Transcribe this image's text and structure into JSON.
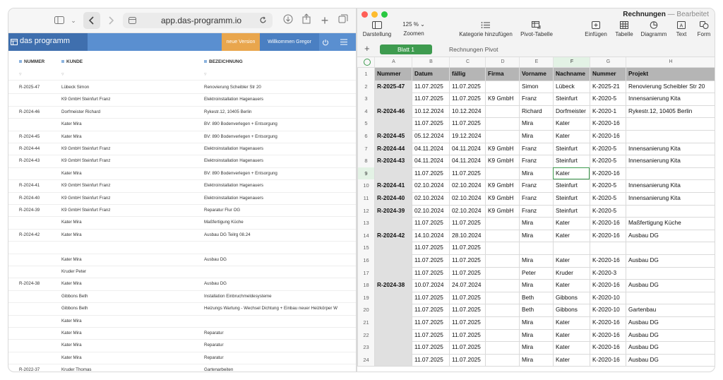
{
  "browser": {
    "url": "app.das-programm.io",
    "app_name": "das programm",
    "new_version": "neue Version",
    "welcome": "Willkommen Gregor",
    "columns": [
      "NUMMER",
      "KUNDE",
      "BEZEICHNUNG"
    ],
    "rows": [
      {
        "nr": "R-2025-47",
        "kunde": "Lübeck Simon",
        "bez": "Renovierung Scheibler Str 20"
      },
      {
        "nr": "",
        "kunde": "K9 GmbH Steinfurt Franz",
        "bez": "Elektroinstallation Hagenauers"
      },
      {
        "nr": "R-2024-46",
        "kunde": "Dorfmeister Richard",
        "bez": "Rykestr.12, 10405 Berlin"
      },
      {
        "nr": "",
        "kunde": "Kater Mira",
        "bez": "BV: 890 Bodenverlegen + Entsorgung"
      },
      {
        "nr": "R-2024-45",
        "kunde": "Kater Mira",
        "bez": "BV: 890 Bodenverlegen + Entsorgung"
      },
      {
        "nr": "R-2024-44",
        "kunde": "K9 GmbH Steinfurt Franz",
        "bez": "Elektroinstallation Hagenauers"
      },
      {
        "nr": "R-2024-43",
        "kunde": "K9 GmbH Steinfurt Franz",
        "bez": "Elektroinstallation Hagenauers"
      },
      {
        "nr": "",
        "kunde": "Kater Mira",
        "bez": "BV: 890 Bodenverlegen + Entsorgung"
      },
      {
        "nr": "R-2024-41",
        "kunde": "K9 GmbH Steinfurt Franz",
        "bez": "Elektroinstallation Hagenauers"
      },
      {
        "nr": "R-2024-40",
        "kunde": "K9 GmbH Steinfurt Franz",
        "bez": "Elektroinstallation Hagenauers"
      },
      {
        "nr": "R-2024-39",
        "kunde": "K9 GmbH Steinfurt Franz",
        "bez": "Reparatur Flur OG"
      },
      {
        "nr": "",
        "kunde": "Kater Mira",
        "bez": "Maßfertigung Küche"
      },
      {
        "nr": "R-2024-42",
        "kunde": "Kater Mira",
        "bez": "Ausbau DG Teilrg 08.24"
      },
      {
        "nr": "",
        "kunde": "",
        "bez": ""
      },
      {
        "nr": "",
        "kunde": "Kater Mira",
        "bez": "Ausbau DG"
      },
      {
        "nr": "",
        "kunde": "Kruder Peter",
        "bez": ""
      },
      {
        "nr": "R-2024-38",
        "kunde": "Kater Mira",
        "bez": "Ausbau DG"
      },
      {
        "nr": "",
        "kunde": "Gibbons Beth",
        "bez": "Installation Einbruchmeldesysteme"
      },
      {
        "nr": "",
        "kunde": "Gibbons Beth",
        "bez": "Heizungs Wartung - Wechsel Dichtung + Einbau neuer Heizkörper W"
      },
      {
        "nr": "",
        "kunde": "Kater Mira",
        "bez": ""
      },
      {
        "nr": "",
        "kunde": "Kater Mira",
        "bez": "Reparatur"
      },
      {
        "nr": "",
        "kunde": "Kater Mira",
        "bez": "Reparatur"
      },
      {
        "nr": "",
        "kunde": "Kater Mira",
        "bez": "Reparatur"
      },
      {
        "nr": "R-2022-37",
        "kunde": "Kruder Thomas",
        "bez": "Gartenarbeiten"
      }
    ]
  },
  "numbers": {
    "doc_title": "Rechnungen",
    "doc_sep": "—",
    "doc_status": "Bearbeitet",
    "zoom": "125 %",
    "toolbar": {
      "darstellung": "Darstellung",
      "zoomen": "Zoomen",
      "kategorie": "Kategorie hinzufügen",
      "pivot": "Pivot-Tabelle",
      "einfuegen": "Einfügen",
      "tabelle": "Tabelle",
      "diagramm": "Diagramm",
      "text": "Text",
      "form": "Form"
    },
    "sheets": [
      "Blatt 1",
      "Rechnungen Pivot"
    ],
    "col_letters": [
      "A",
      "B",
      "C",
      "D",
      "E",
      "F",
      "G",
      "H"
    ],
    "header": [
      "Nummer",
      "Datum",
      "fällig",
      "Firma",
      "Vorname",
      "Nachname",
      "Nummer",
      "Projekt"
    ],
    "rows": [
      [
        "R-2025-47",
        "11.07.2025",
        "11.07.2025",
        "",
        "Simon",
        "Lübeck",
        "K-2025-21",
        "Renovierung Scheibler Str 20"
      ],
      [
        "",
        "11.07.2025",
        "11.07.2025",
        "K9 GmbH",
        "Franz",
        "Steinfurt",
        "K-2020-5",
        "Innensanierung Kita"
      ],
      [
        "R-2024-46",
        "10.12.2024",
        "10.12.2024",
        "",
        "Richard",
        "Dorfmeister",
        "K-2020-1",
        "Rykestr.12, 10405 Berlin"
      ],
      [
        "",
        "11.07.2025",
        "11.07.2025",
        "",
        "Mira",
        "Kater",
        "K-2020-16",
        ""
      ],
      [
        "R-2024-45",
        "05.12.2024",
        "19.12.2024",
        "",
        "Mira",
        "Kater",
        "K-2020-16",
        ""
      ],
      [
        "R-2024-44",
        "04.11.2024",
        "04.11.2024",
        "K9 GmbH",
        "Franz",
        "Steinfurt",
        "K-2020-5",
        "Innensanierung Kita"
      ],
      [
        "R-2024-43",
        "04.11.2024",
        "04.11.2024",
        "K9 GmbH",
        "Franz",
        "Steinfurt",
        "K-2020-5",
        "Innensanierung Kita"
      ],
      [
        "",
        "11.07.2025",
        "11.07.2025",
        "",
        "Mira",
        "Kater",
        "K-2020-16",
        ""
      ],
      [
        "R-2024-41",
        "02.10.2024",
        "02.10.2024",
        "K9 GmbH",
        "Franz",
        "Steinfurt",
        "K-2020-5",
        "Innensanierung Kita"
      ],
      [
        "R-2024-40",
        "02.10.2024",
        "02.10.2024",
        "K9 GmbH",
        "Franz",
        "Steinfurt",
        "K-2020-5",
        "Innensanierung Kita"
      ],
      [
        "R-2024-39",
        "02.10.2024",
        "02.10.2024",
        "K9 GmbH",
        "Franz",
        "Steinfurt",
        "K-2020-5",
        ""
      ],
      [
        "",
        "11.07.2025",
        "11.07.2025",
        "",
        "Mira",
        "Kater",
        "K-2020-16",
        "Maßfertigung Küche"
      ],
      [
        "R-2024-42",
        "14.10.2024",
        "28.10.2024",
        "",
        "Mira",
        "Kater",
        "K-2020-16",
        "Ausbau DG"
      ],
      [
        "",
        "11.07.2025",
        "11.07.2025",
        "",
        "",
        "",
        "",
        ""
      ],
      [
        "",
        "11.07.2025",
        "11.07.2025",
        "",
        "Mira",
        "Kater",
        "K-2020-16",
        "Ausbau DG"
      ],
      [
        "",
        "11.07.2025",
        "11.07.2025",
        "",
        "Peter",
        "Kruder",
        "K-2020-3",
        ""
      ],
      [
        "R-2024-38",
        "10.07.2024",
        "24.07.2024",
        "",
        "Mira",
        "Kater",
        "K-2020-16",
        "Ausbau DG"
      ],
      [
        "",
        "11.07.2025",
        "11.07.2025",
        "",
        "Beth",
        "Gibbons",
        "K-2020-10",
        ""
      ],
      [
        "",
        "11.07.2025",
        "11.07.2025",
        "",
        "Beth",
        "Gibbons",
        "K-2020-10",
        "Gartenbau"
      ],
      [
        "",
        "11.07.2025",
        "11.07.2025",
        "",
        "Mira",
        "Kater",
        "K-2020-16",
        "Ausbau DG"
      ],
      [
        "",
        "11.07.2025",
        "11.07.2025",
        "",
        "Mira",
        "Kater",
        "K-2020-16",
        "Ausbau DG"
      ],
      [
        "",
        "11.07.2025",
        "11.07.2025",
        "",
        "Mira",
        "Kater",
        "K-2020-16",
        "Ausbau DG"
      ],
      [
        "",
        "11.07.2025",
        "11.07.2025",
        "",
        "Mira",
        "Kater",
        "K-2020-16",
        "Ausbau DG"
      ]
    ],
    "selected_row": 9,
    "selected_col": "F"
  },
  "colors": {
    "app_header": "#5a8fd0",
    "app_logo_bg": "#3f6fae",
    "new_version_bg": "#e9a64d",
    "sheet_tab_active": "#3e9b4f",
    "header_row_bg": "#b5b5b5",
    "number_col_bg": "#e0e0e0"
  }
}
